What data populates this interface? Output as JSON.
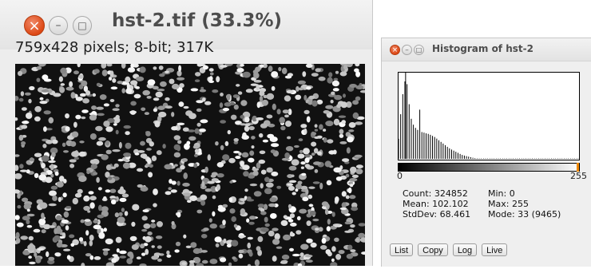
{
  "image_window": {
    "title": "hst-2.tif (33.3%)",
    "info": "759x428 pixels; 8-bit; 317K",
    "controls": {
      "close": "×",
      "minimize": "–",
      "maximize": "□"
    }
  },
  "histogram_window": {
    "title": "Histogram of hst-2",
    "controls": {
      "close": "×",
      "minimize": "–",
      "maximize": "□"
    },
    "x_min_label": "0",
    "x_max_label": "255",
    "stats_left": [
      "Count: 324852",
      "Mean: 102.102",
      "StdDev: 68.461"
    ],
    "stats_right": [
      "Min: 0",
      "Max: 255",
      "Mode: 33 (9465)"
    ],
    "buttons": [
      "List",
      "Copy",
      "Log",
      "Live"
    ]
  },
  "chart_data": {
    "type": "bar",
    "x_range": [
      0,
      255
    ],
    "y_max": 9465,
    "bin_step": 3,
    "values": [
      2200,
      3100,
      4000,
      4900,
      5800,
      6500,
      7100,
      7700,
      8100,
      8500,
      9465,
      8800,
      8200,
      7500,
      6800,
      6000,
      5300,
      4800,
      4400,
      4100,
      3900,
      3750,
      3600,
      3500,
      3400,
      3320,
      3250,
      3180,
      3120,
      3060,
      5400,
      3000,
      2980,
      2940,
      2920,
      2900,
      2880,
      2860,
      2830,
      2800,
      2780,
      2760,
      2740,
      2700,
      2680,
      2640,
      2600,
      2560,
      2520,
      2480,
      2440,
      2400,
      2340,
      2280,
      2220,
      2160,
      2100,
      2040,
      1980,
      1920,
      1860,
      1800,
      1740,
      1680,
      1620,
      1560,
      1500,
      1440,
      1380,
      1320,
      1260,
      1200,
      1150,
      1100,
      1060,
      1020,
      980,
      940,
      900,
      860,
      820,
      780,
      740,
      700,
      660,
      620,
      580,
      540,
      500,
      460,
      430,
      400,
      380,
      360,
      340,
      320,
      300,
      280,
      260,
      240,
      220,
      200,
      180,
      160,
      140,
      120,
      100,
      90,
      80,
      70,
      60,
      50,
      45,
      40,
      35,
      30,
      25,
      20,
      15,
      10,
      8,
      6,
      4,
      3,
      2,
      1,
      1,
      1,
      1,
      1,
      1,
      1,
      1,
      1,
      1,
      1,
      1,
      1,
      1,
      1,
      1,
      1,
      1,
      1,
      1,
      1,
      1,
      1,
      1,
      1,
      1,
      1,
      1,
      1,
      1,
      1,
      1,
      1,
      1,
      1,
      1,
      1,
      1,
      1,
      1,
      1,
      1,
      1,
      1,
      1,
      1,
      1,
      1,
      1,
      1,
      1,
      1,
      1,
      1,
      1,
      1,
      1,
      1,
      1,
      1,
      1,
      1,
      1,
      1,
      1,
      1,
      1,
      1,
      1,
      1,
      1,
      1,
      1,
      1,
      1,
      1,
      1,
      1,
      1,
      1,
      1,
      1,
      1,
      1,
      1,
      1,
      1,
      1,
      1,
      1,
      1,
      1,
      1,
      1,
      1,
      1,
      1,
      1,
      1,
      1,
      1,
      1,
      1,
      1,
      1,
      1,
      1,
      1,
      1,
      1,
      1,
      1,
      1,
      1,
      1,
      1,
      1,
      1,
      1,
      1,
      1,
      1,
      1,
      1,
      1,
      1,
      1,
      1,
      1,
      1,
      1
    ]
  }
}
